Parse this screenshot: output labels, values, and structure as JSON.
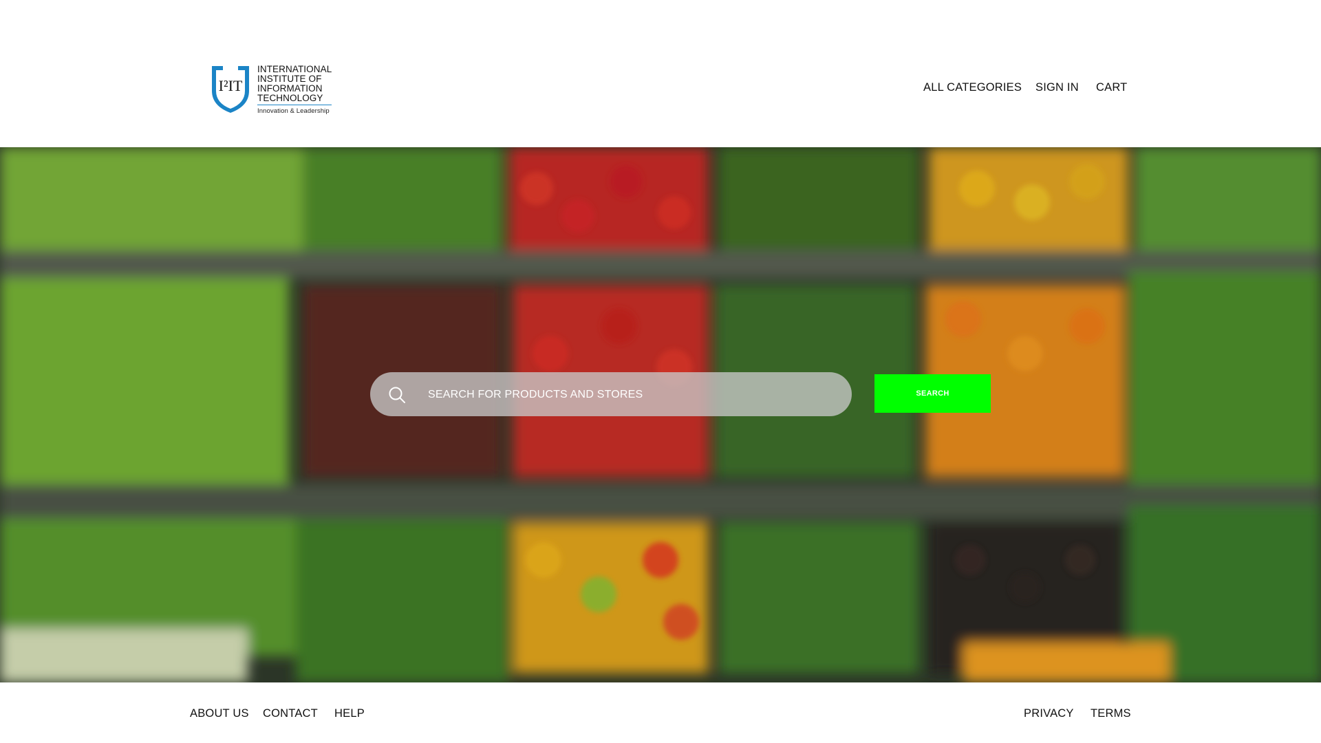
{
  "header": {
    "logo": {
      "mark": "I²IT",
      "lines": [
        "INTERNATIONAL",
        "INSTITUTE OF",
        "INFORMATION",
        "TECHNOLOGY"
      ],
      "tagline": "Innovation & Leadership",
      "color": "#1b84c6"
    },
    "nav": {
      "all_categories": "ALL CATEGORIES",
      "sign_in": "SIGN IN",
      "cart": "CART"
    },
    "more_menu_icon": "kebab-menu-icon"
  },
  "hero": {
    "search": {
      "placeholder": "SEARCH FOR PRODUCTS AND STORES",
      "value": "",
      "icon": "search-icon"
    },
    "search_button_label": "SEARCH",
    "search_button_color": "#00ff00"
  },
  "footer": {
    "left_links": [
      "ABOUT US",
      "CONTACT",
      "HELP"
    ],
    "right_links": [
      "PRIVACY",
      "TERMS"
    ]
  }
}
